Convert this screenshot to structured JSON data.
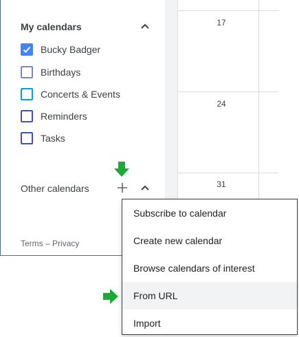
{
  "sidebar": {
    "my_calendars": {
      "title": "My calendars",
      "items": [
        {
          "label": "Bucky Badger",
          "checked": true,
          "color": "#4285f4"
        },
        {
          "label": "Birthdays",
          "checked": false,
          "color": "#7986cb"
        },
        {
          "label": "Concerts & Events",
          "checked": false,
          "color": "#039be5"
        },
        {
          "label": "Reminders",
          "checked": false,
          "color": "#3f51b5"
        },
        {
          "label": "Tasks",
          "checked": false,
          "color": "#3f51b5"
        }
      ]
    },
    "other_calendars": {
      "title": "Other calendars"
    },
    "footer": {
      "terms": "Terms",
      "separator": "–",
      "privacy": "Privacy"
    }
  },
  "calendar": {
    "days": [
      "17",
      "24",
      "31"
    ]
  },
  "menu": {
    "items": [
      {
        "label": "Subscribe to calendar"
      },
      {
        "label": "Create new calendar"
      },
      {
        "label": "Browse calendars of interest"
      },
      {
        "label": "From URL"
      },
      {
        "label": "Import"
      }
    ],
    "highlighted_index": 3
  },
  "colors": {
    "accent": "#1a73e8",
    "checked": "#4285f4",
    "annotation_arrow": "#1fa83a",
    "menu_hover": "#f1f3f4"
  }
}
